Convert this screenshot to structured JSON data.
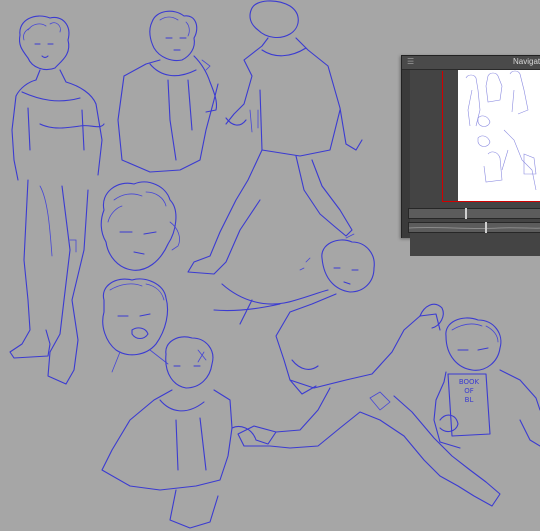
{
  "navigator": {
    "title": "Navigator",
    "menu_icon": "menu-icon",
    "zoom_level": 0.42,
    "rotation_level": 0.57
  },
  "colors": {
    "canvas_background": "#a6a6a6",
    "sketch_line": "#3b3bd1",
    "panel_background": "#3a3a3a",
    "view_rectangle": "#d10000"
  },
  "canvas": {
    "book_text": [
      "BOOK",
      "OF",
      "BL"
    ]
  }
}
